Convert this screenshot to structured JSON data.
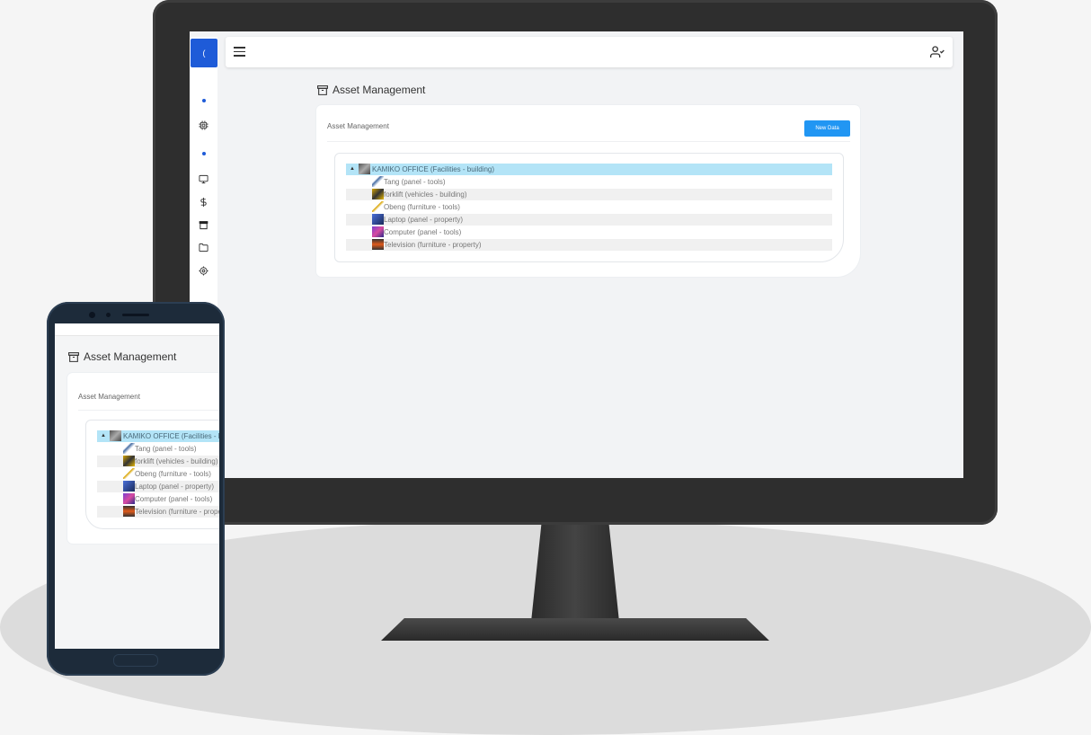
{
  "app": {
    "title": "Asset Management",
    "logo_text": "(",
    "sidebar_icons": [
      "dot-icon",
      "cpu-icon",
      "dot-icon",
      "monitor-icon",
      "dollar-icon",
      "archive-icon",
      "folder-icon",
      "settings-icon"
    ]
  },
  "card": {
    "title": "Asset Management",
    "new_button": "New Data"
  },
  "tree": {
    "root": "KAMIKO OFFICE (Facilities - building)",
    "items": [
      "Tang (panel - tools)",
      "forklift (vehicles - building)",
      "Obeng (furniture - tools)",
      "Laptop (panel - property)",
      "Computer (panel - tools)",
      "Television (furniture - property)"
    ]
  },
  "colors": {
    "accent": "#1e5bd8",
    "button": "#2196f3",
    "selected_row": "#b3e4f7"
  }
}
